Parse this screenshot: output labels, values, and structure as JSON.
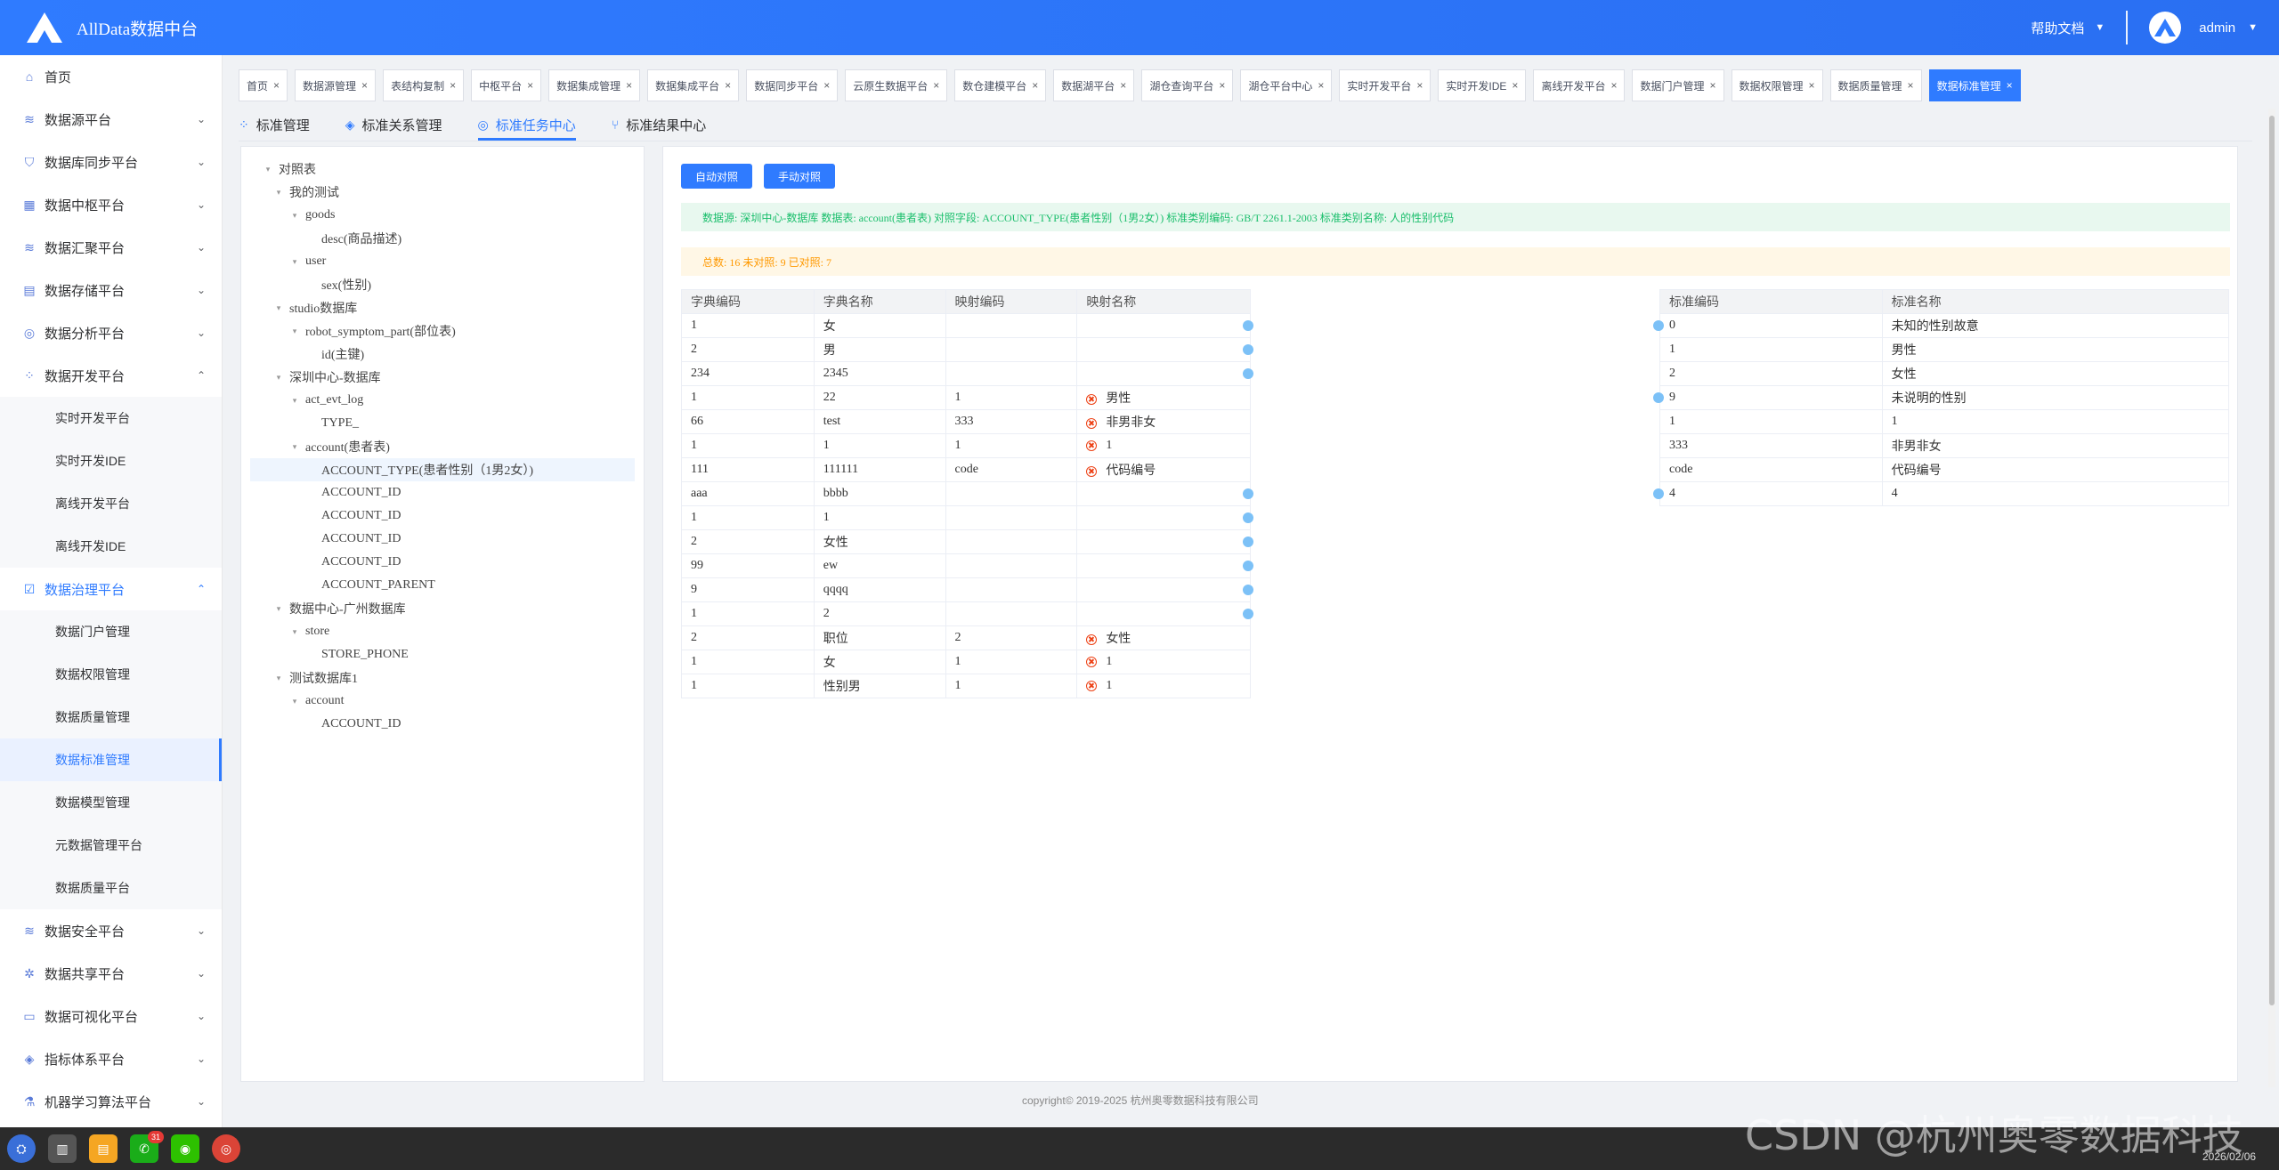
{
  "app": {
    "title": "AllData数据中台"
  },
  "header": {
    "help": "帮助文档",
    "user": "admin"
  },
  "sidebar": {
    "items": [
      {
        "label": "首页",
        "icon": "home-icon"
      },
      {
        "label": "数据源平台",
        "icon": "database-icon"
      },
      {
        "label": "数据库同步平台",
        "icon": "shield-icon"
      },
      {
        "label": "数据中枢平台",
        "icon": "grid-icon"
      },
      {
        "label": "数据汇聚平台",
        "icon": "database-icon"
      },
      {
        "label": "数据存储平台",
        "icon": "chart-icon"
      },
      {
        "label": "数据分析平台",
        "icon": "analysis-icon"
      },
      {
        "label": "数据开发平台",
        "icon": "apps-icon"
      }
    ],
    "dev_sub": [
      "实时开发平台",
      "实时开发IDE",
      "离线开发平台",
      "离线开发IDE"
    ],
    "governance": {
      "label": "数据治理平台",
      "icon": "check-square-icon"
    },
    "gov_sub": [
      "数据门户管理",
      "数据权限管理",
      "数据质量管理",
      "数据标准管理",
      "数据模型管理",
      "元数据管理平台",
      "数据质量平台"
    ],
    "bottom_items": [
      {
        "label": "数据安全平台",
        "icon": "database-icon"
      },
      {
        "label": "数据共享平台",
        "icon": "share-icon"
      },
      {
        "label": "数据可视化平台",
        "icon": "monitor-icon"
      },
      {
        "label": "指标体系平台",
        "icon": "cube-icon"
      },
      {
        "label": "机器学习算法平台",
        "icon": "ml-icon"
      }
    ]
  },
  "page_tabs": [
    "首页",
    "数据源管理",
    "表结构复制",
    "中枢平台",
    "数据集成管理",
    "数据集成平台",
    "数据同步平台",
    "云原生数据平台",
    "数仓建模平台",
    "数据湖平台",
    "湖仓查询平台",
    "湖仓平台中心",
    "实时开发平台",
    "实时开发IDE",
    "离线开发平台",
    "数据门户管理",
    "数据权限管理",
    "数据质量管理",
    "数据标准管理"
  ],
  "sub_tabs": [
    "标准管理",
    "标准关系管理",
    "标准任务中心",
    "标准结果中心"
  ],
  "tree": [
    {
      "label": "对照表"
    },
    {
      "label": "我的测试"
    },
    {
      "label": "goods"
    },
    {
      "label": "desc(商品描述)"
    },
    {
      "label": "user"
    },
    {
      "label": "sex(性别)"
    },
    {
      "label": "studio数据库"
    },
    {
      "label": "robot_symptom_part(部位表)"
    },
    {
      "label": "id(主键)"
    },
    {
      "label": "深圳中心-数据库"
    },
    {
      "label": "act_evt_log"
    },
    {
      "label": "TYPE_"
    },
    {
      "label": "account(患者表)"
    },
    {
      "label": "ACCOUNT_TYPE(患者性别（1男2女）)"
    },
    {
      "label": "ACCOUNT_ID"
    },
    {
      "label": "ACCOUNT_ID"
    },
    {
      "label": "ACCOUNT_ID"
    },
    {
      "label": "ACCOUNT_ID"
    },
    {
      "label": "ACCOUNT_PARENT"
    },
    {
      "label": "数据中心-广州数据库"
    },
    {
      "label": "store"
    },
    {
      "label": "STORE_PHONE"
    },
    {
      "label": "测试数据库1"
    },
    {
      "label": "account"
    },
    {
      "label": "ACCOUNT_ID"
    }
  ],
  "buttons": {
    "auto": "自动对照",
    "manual": "手动对照"
  },
  "info": {
    "success": "数据源: 深圳中心-数据库 数据表: account(患者表) 对照字段: ACCOUNT_TYPE(患者性别（1男2女）) 标准类别编码: GB/T 2261.1-2003 标准类别名称: 人的性别代码",
    "warn": "总数: 16 未对照: 9 已对照: 7"
  },
  "left_table": {
    "headers": [
      "字典编码",
      "字典名称",
      "映射编码",
      "映射名称"
    ],
    "rows": [
      [
        "1",
        "女",
        "",
        ""
      ],
      [
        "2",
        "男",
        "",
        ""
      ],
      [
        "234",
        "2345",
        "",
        ""
      ],
      [
        "1",
        "22",
        "1",
        "男性"
      ],
      [
        "66",
        "test",
        "333",
        "非男非女"
      ],
      [
        "1",
        "1",
        "1",
        "1"
      ],
      [
        "111",
        "111111",
        "code",
        "代码编号"
      ],
      [
        "aaa",
        "bbbb",
        "",
        ""
      ],
      [
        "1",
        "1",
        "",
        ""
      ],
      [
        "2",
        "女性",
        "",
        ""
      ],
      [
        "99",
        "ew",
        "",
        ""
      ],
      [
        "9",
        "qqqq",
        "",
        ""
      ],
      [
        "1",
        "2",
        "",
        ""
      ],
      [
        "2",
        "职位",
        "2",
        "女性"
      ],
      [
        "1",
        "女",
        "1",
        "1"
      ],
      [
        "1",
        "性别男",
        "1",
        "1"
      ]
    ]
  },
  "right_table": {
    "headers": [
      "标准编码",
      "标准名称"
    ],
    "rows": [
      [
        "0",
        "未知的性别故意"
      ],
      [
        "1",
        "男性"
      ],
      [
        "2",
        "女性"
      ],
      [
        "9",
        "未说明的性别"
      ],
      [
        "1",
        "1"
      ],
      [
        "333",
        "非男非女"
      ],
      [
        "code",
        "代码编号"
      ],
      [
        "4",
        "4"
      ]
    ]
  },
  "footer": "copyright© 2019-2025 杭州奥零数据科技有限公司",
  "taskbar": {
    "badge": "31",
    "watermark": "CSDN @杭州奥零数据科技",
    "date": "2026/02/06"
  }
}
